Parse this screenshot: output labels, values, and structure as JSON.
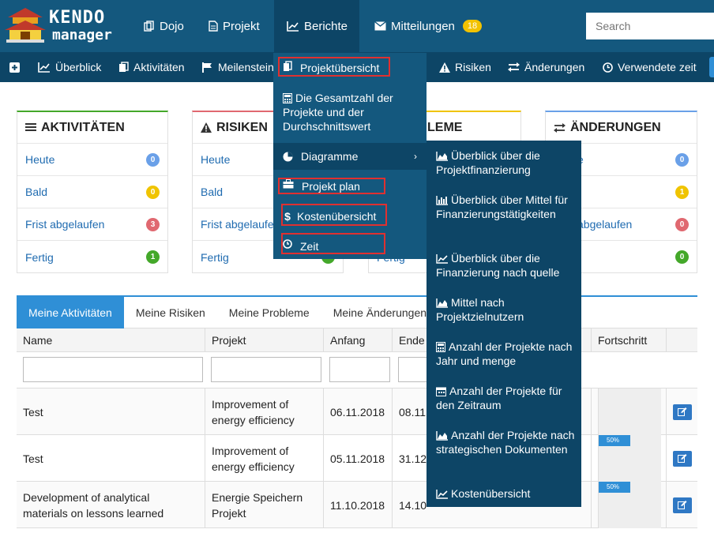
{
  "logo": {
    "line1": "KENDO",
    "line2": "manager"
  },
  "nav": [
    {
      "label": "Dojo",
      "icon": "copy-icon"
    },
    {
      "label": "Projekt",
      "icon": "file-icon"
    },
    {
      "label": "Berichte",
      "icon": "chart-icon"
    },
    {
      "label": "Mitteilungen",
      "icon": "envelope-icon",
      "badge": "18"
    }
  ],
  "search": {
    "placeholder": "Search"
  },
  "subnav": [
    {
      "label": "",
      "icon": "plus-icon"
    },
    {
      "label": "Überblick",
      "icon": "chart-icon"
    },
    {
      "label": "Aktivitäten",
      "icon": "copy-icon"
    },
    {
      "label": "Meilenstein",
      "icon": "flag-icon"
    },
    {
      "label": "Risiken",
      "icon": "warning-icon"
    },
    {
      "label": "Änderungen",
      "icon": "exchange-icon"
    },
    {
      "label": "Verwendete zeit",
      "icon": "clock-icon"
    }
  ],
  "berichte_menu": [
    {
      "label": "Projektübersicht"
    },
    {
      "label": "Die Gesamtzahl der Projekte und der Durchschnittswert"
    },
    {
      "label": "Diagramme"
    },
    {
      "label": "Projekt plan"
    },
    {
      "label": "Kostenübersicht"
    },
    {
      "label": "Zeit"
    }
  ],
  "diagramme_submenu": [
    "Überblick über die Projektfinanzierung",
    "Überblick über Mittel für Finanzierungstätigkeiten",
    "Überblick über die Finanzierung nach quelle",
    "Mittel nach Projektzielnutzern",
    "Anzahl der Projekte nach Jahr und menge",
    "Anzahl der Projekte für den Zeitraum",
    "Anzahl der Projekte nach strategischen Dokumenten",
    "Kostenübersicht"
  ],
  "panels": [
    {
      "title": "AKTIVITÄTEN",
      "rows": [
        {
          "label": "Heute",
          "count": "0",
          "color": "#6aa0e8"
        },
        {
          "label": "Bald",
          "count": "0",
          "color": "#f0c400"
        },
        {
          "label": "Frist abgelaufen",
          "count": "3",
          "color": "#e06870"
        },
        {
          "label": "Fertig",
          "count": "1",
          "color": "#44a82a"
        }
      ]
    },
    {
      "title": "RISIKEN",
      "rows": [
        {
          "label": "Heute"
        },
        {
          "label": "Bald"
        },
        {
          "label": "Frist abgelaufen"
        },
        {
          "label": "Fertig"
        }
      ]
    },
    {
      "title": "LEME",
      "rows": [
        {
          "label": "Fertig"
        }
      ]
    },
    {
      "title": "ÄNDERUNGEN",
      "rows": [
        {
          "label": "e",
          "count": "0",
          "color": "#6aa0e8"
        },
        {
          "label": "",
          "count": "1",
          "color": "#f0c400"
        },
        {
          "label": "abgelaufen",
          "count": "0",
          "color": "#e06870"
        },
        {
          "label": "",
          "count": "0",
          "color": "#44a82a"
        }
      ]
    }
  ],
  "tabs": [
    "Meine Aktivitäten",
    "Meine Risiken",
    "Meine Probleme",
    "Meine Änderungen"
  ],
  "columns": {
    "name": "Name",
    "projekt": "Projekt",
    "anfang": "Anfang",
    "ende": "Ende",
    "fortschritt": "Fortschritt"
  },
  "rows": [
    {
      "name": "Test",
      "projekt": "Improvement of energy efficiency",
      "anfang": "06.11.2018",
      "ende": "08.11",
      "progress": 0,
      "progress_label": ""
    },
    {
      "name": "Test",
      "projekt": "Improvement of energy efficiency",
      "anfang": "05.11.2018",
      "ende": "31.12",
      "progress": 50,
      "progress_label": "50%"
    },
    {
      "name": "Development of analytical materials on lessons learned",
      "projekt": "Energie Speichern Projekt",
      "anfang": "11.10.2018",
      "ende": "14.10",
      "progress": 50,
      "progress_label": "50%"
    }
  ]
}
